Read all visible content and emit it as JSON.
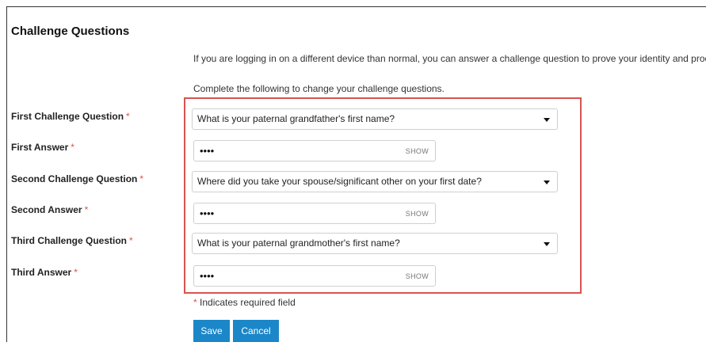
{
  "header": {
    "title": "Challenge Questions"
  },
  "intro_text": "If you are logging in on a different device than normal, you can answer a challenge question to prove your identity and proceed.",
  "instructions_text": "Complete the following to change your challenge questions.",
  "required_marker": "*",
  "fields": [
    {
      "label": "First Challenge Question",
      "type": "select",
      "value": "What is your paternal grandfather's first name?",
      "icon": "dropdown-arrow-icon"
    },
    {
      "label": "First Answer",
      "type": "password",
      "value": "••••",
      "toggle_label": "SHOW"
    },
    {
      "label": "Second Challenge Question",
      "type": "select",
      "value": "Where did you take your spouse/significant other on your first date?",
      "icon": "dropdown-arrow-icon"
    },
    {
      "label": "Second Answer",
      "type": "password",
      "value": "••••",
      "toggle_label": "SHOW"
    },
    {
      "label": "Third Challenge Question",
      "type": "select",
      "value": "What is your paternal grandmother's first name?",
      "icon": "dropdown-arrow-icon"
    },
    {
      "label": "Third Answer",
      "type": "password",
      "value": "••••",
      "toggle_label": "SHOW"
    }
  ],
  "required_note": "Indicates required field",
  "buttons": {
    "save": "Save",
    "cancel": "Cancel"
  },
  "colors": {
    "accent": "#1b87c9",
    "required": "#d9534f",
    "highlight_border": "#d9534f"
  }
}
